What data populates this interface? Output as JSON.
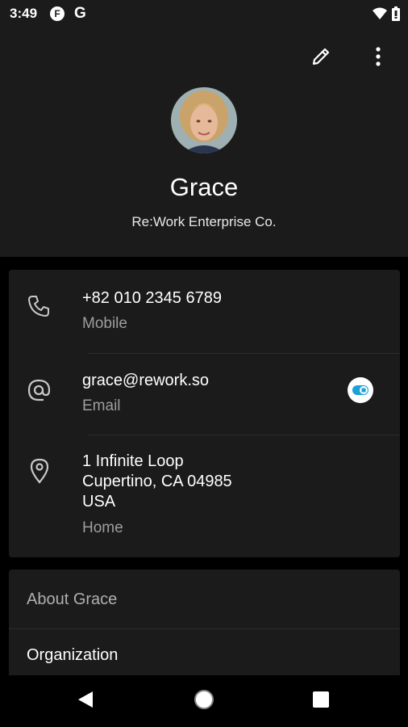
{
  "status_bar": {
    "time": "3:49",
    "badge_letter": "F",
    "g_letter": "G",
    "icons": [
      "wifi-icon",
      "battery-icon"
    ]
  },
  "toolbar": {
    "icons": [
      "edit-icon",
      "more-vert-icon"
    ]
  },
  "contact": {
    "name": "Grace",
    "company": "Re:Work Enterprise Co."
  },
  "phone": {
    "icon": "phone-icon",
    "number": "+82 010 2345 6789",
    "type": "Mobile"
  },
  "email": {
    "icon": "at-icon",
    "address": "grace@rework.so",
    "type": "Email",
    "action_icon": "app-message-icon"
  },
  "address": {
    "icon": "location-pin-icon",
    "line1": "1 Infinite Loop",
    "line2": "Cupertino, CA 04985",
    "line3": "USA",
    "type": "Home"
  },
  "about": {
    "title": "About Grace",
    "organization_label": "Organization"
  },
  "colors": {
    "background": "#000000",
    "surface": "#1b1b1b",
    "secondary_text": "#9e9e9e",
    "accent": "#1aa1d8"
  }
}
